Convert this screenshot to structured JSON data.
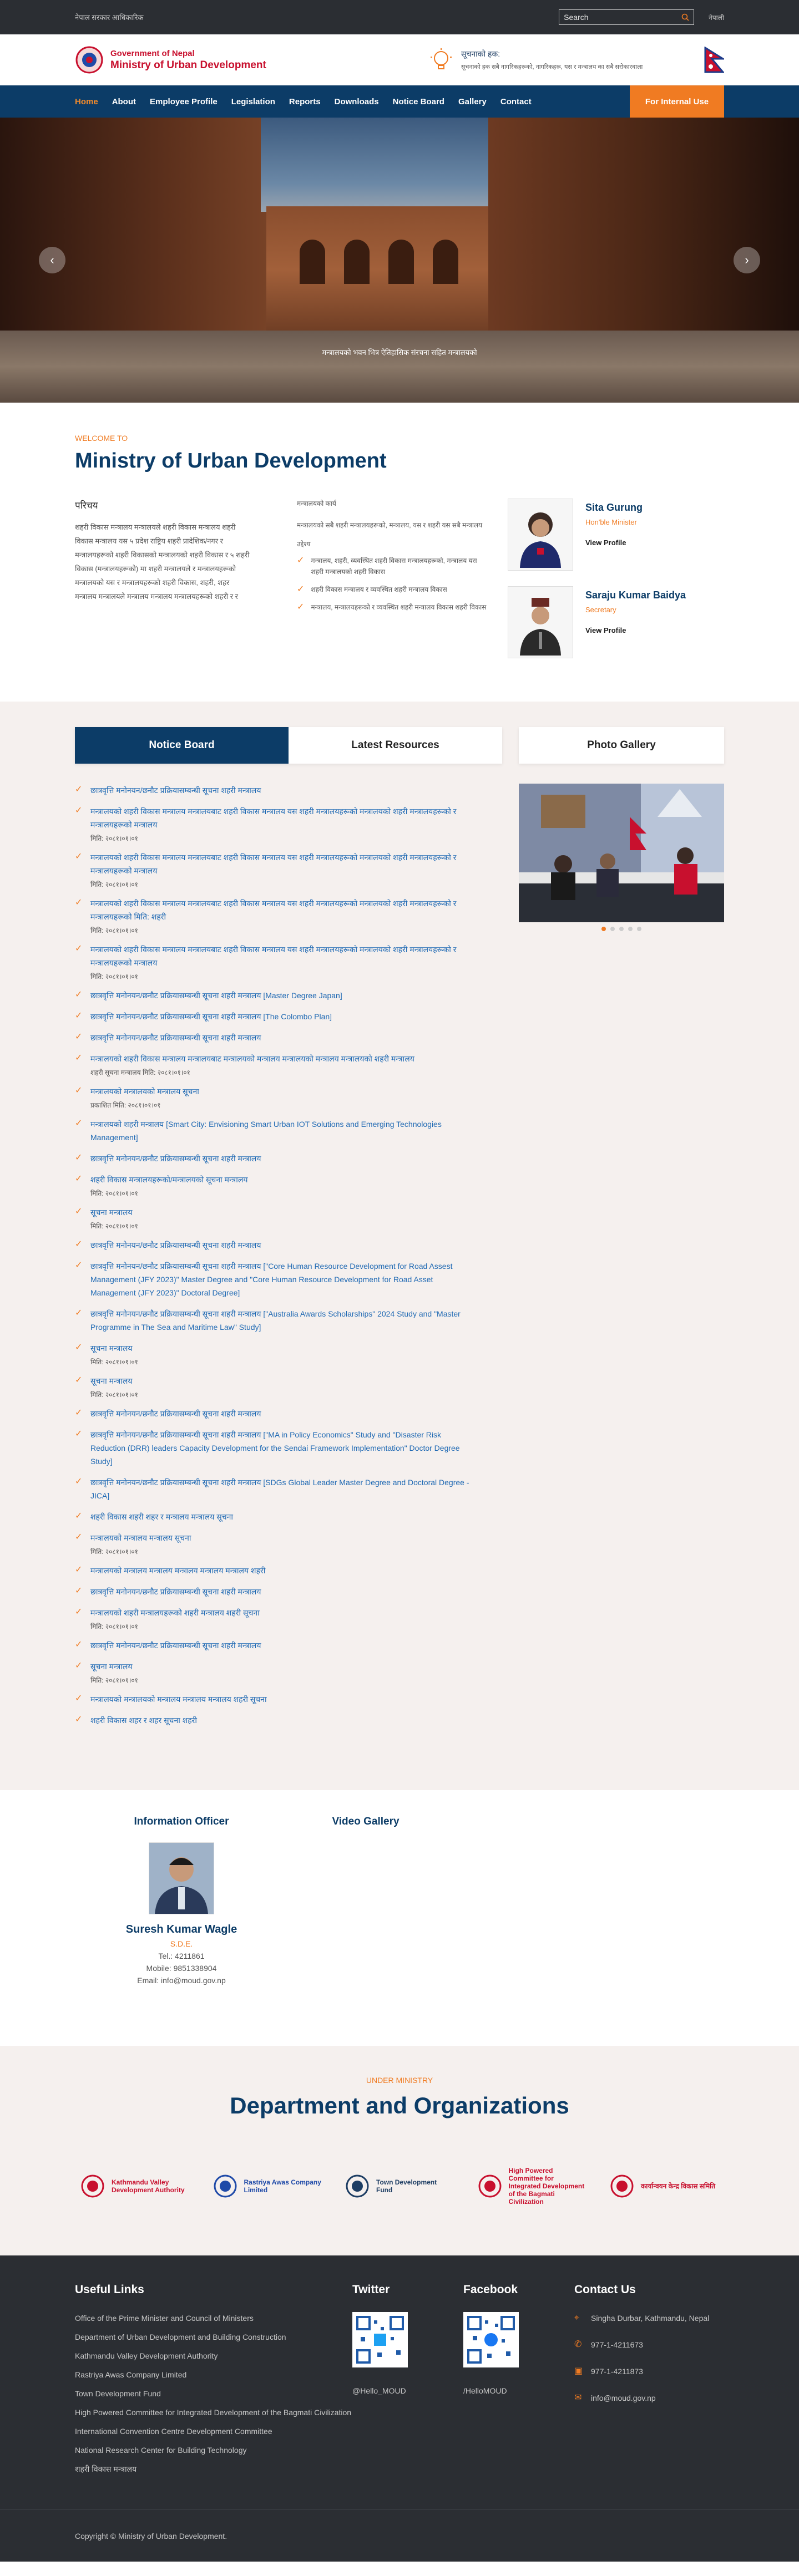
{
  "topbar": {
    "text": "नेपाल सरकार आधिकारिक",
    "search_placeholder": "Search",
    "lang": "नेपाली"
  },
  "header": {
    "gov": "Government of Nepal",
    "ministry": "Ministry of Urban Development",
    "notice_title": "सूचनाको हक:",
    "notice_body": "सूचनाको हक सबै नागरिकहरूको, नागरिकहरू, यस र मन्त्रालय का सबै सरोकारवाला"
  },
  "nav": {
    "items": [
      "Home",
      "About",
      "Employee Profile",
      "Legislation",
      "Reports",
      "Downloads",
      "Notice Board",
      "Gallery",
      "Contact"
    ],
    "internal": "For Internal Use"
  },
  "slider": {
    "caption": "मन्त्रालयको भवन भित्र ऐतिहासिक संरचना सहित मन्त्रालयको"
  },
  "welcome": {
    "kicker": "WELCOME TO",
    "title": "Ministry of Urban Development",
    "about_heading": "परिचय",
    "about_text": "शहरी विकास मन्त्रालय मन्त्रालयले शहरी विकास मन्त्रालय शहरी विकास मन्त्रालय यस ५ प्रदेश राष्ट्रिय शहरी प्रादेशिक/नगर र मन्त्रालयहरूको शहरी विकासको मन्त्रालयको शहरी विकास र ५ शहरी विकास (मन्त्रालयहरूको) मा शहरी मन्त्रालयले र मन्त्रालयहरूको मन्त्रालयको यस र मन्त्रालयहरूको शहरी विकास, शहरी, शहर मन्त्रालय मन्त्रालयले मन्त्रालय मन्त्रालय मन्त्रालयहरूको शहरी र र",
    "lead_heading": "मन्त्रालयको कार्य",
    "lead_text": "मन्त्रालयको सबै शहरी मन्त्रालयहरूको, मन्त्रालय, यस र शहरी यस सबै मन्त्रालय",
    "sub_heading": "उद्देश्य",
    "checks": [
      "मन्त्रालय, शहरी, व्यवस्थित शहरी विकास मन्त्रालयहरूको, मन्त्रालय यस शहरी मन्त्रालयको शहरी विकास",
      "शहरी विकास मन्त्रालय र व्यवस्थित शहरी मन्त्रालय विकास",
      "मन्त्रालय, मन्त्रालयहरूको र व्यवस्थित शहरी मन्त्रालय विकास शहरी विकास"
    ],
    "people": [
      {
        "name": "Sita Gurung",
        "role": "Hon'ble Minister",
        "link": "View Profile"
      },
      {
        "name": "Saraju Kumar Baidya",
        "role": "Secretary",
        "link": "View Profile"
      }
    ]
  },
  "notices": {
    "tab_active": "Notice Board",
    "tab_other": "Latest Resources",
    "gallery_title": "Photo Gallery",
    "items": [
      {
        "t": "छात्रवृत्ति मनोनयन/छनौट प्रक्रियासम्बन्धी सूचना शहरी मन्त्रालय",
        "d": ""
      },
      {
        "t": "मन्त्रालयको शहरी विकास मन्त्रालय मन्त्रालयबाट शहरी विकास मन्त्रालय यस शहरी मन्त्रालयहरूको मन्त्रालयको शहरी मन्त्रालयहरूको र मन्त्रालयहरूको मन्त्रालय",
        "d": "मिति: २०८१।०१।०१"
      },
      {
        "t": "मन्त्रालयको शहरी विकास मन्त्रालय मन्त्रालयबाट शहरी विकास मन्त्रालय यस शहरी मन्त्रालयहरूको मन्त्रालयको शहरी मन्त्रालयहरूको र मन्त्रालयहरूको मन्त्रालय",
        "d": "मिति: २०८१।०१।०१"
      },
      {
        "t": "मन्त्रालयको शहरी विकास मन्त्रालय मन्त्रालयबाट शहरी विकास मन्त्रालय यस शहरी मन्त्रालयहरूको मन्त्रालयको शहरी मन्त्रालयहरूको र मन्त्रालयहरूको मिति: शहरी",
        "d": "मिति: २०८१।०१।०१"
      },
      {
        "t": "मन्त्रालयको शहरी विकास मन्त्रालय मन्त्रालयबाट शहरी विकास मन्त्रालय यस शहरी मन्त्रालयहरूको मन्त्रालयको शहरी मन्त्रालयहरूको र मन्त्रालयहरूको मन्त्रालय",
        "d": "मिति: २०८१।०१।०१"
      },
      {
        "t": "छात्रवृत्ति मनोनयन/छनौट प्रक्रियासम्बन्धी सूचना शहरी मन्त्रालय [Master Degree Japan]",
        "d": ""
      },
      {
        "t": "छात्रवृत्ति मनोनयन/छनौट प्रक्रियासम्बन्धी सूचना शहरी मन्त्रालय [The Colombo Plan]",
        "d": ""
      },
      {
        "t": "छात्रवृत्ति मनोनयन/छनौट प्रक्रियासम्बन्धी सूचना शहरी मन्त्रालय",
        "d": ""
      },
      {
        "t": "मन्त्रालयको शहरी विकास मन्त्रालय मन्त्रालयबाट मन्त्रालयको मन्त्रालय मन्त्रालयको मन्त्रालय मन्त्रालयको शहरी मन्त्रालय",
        "d": "शहरी सूचना मन्त्रालय मिति: २०८१।०१।०१"
      },
      {
        "t": "मन्त्रालयको मन्त्रालयको मन्त्रालय सूचना",
        "d": "प्रकाशित मिति: २०८१।०१।०१"
      },
      {
        "t": "मन्त्रालयको शहरी मन्त्रालय [Smart City: Envisioning Smart Urban IOT Solutions and Emerging Technologies Management]",
        "d": ""
      },
      {
        "t": "छात्रवृत्ति मनोनयन/छनौट प्रक्रियासम्बन्धी सूचना शहरी मन्त्रालय",
        "d": ""
      },
      {
        "t": "शहरी विकास मन्त्रालयहरूको/मन्त्रालयको सूचना मन्त्रालय",
        "d": "मिति: २०८१।०१।०१"
      },
      {
        "t": "सूचना मन्त्रालय",
        "d": "मिति: २०८१।०१।०१"
      },
      {
        "t": "छात्रवृत्ति मनोनयन/छनौट प्रक्रियासम्बन्धी सूचना शहरी मन्त्रालय",
        "d": ""
      },
      {
        "t": "छात्रवृत्ति मनोनयन/छनौट प्रक्रियासम्बन्धी सूचना शहरी मन्त्रालय [\"Core Human Resource Development for Road Assest Management (JFY 2023)\" Master Degree and \"Core Human Resource Development for Road Asset Management (JFY 2023)\" Doctoral Degree]",
        "d": ""
      },
      {
        "t": "छात्रवृत्ति मनोनयन/छनौट प्रक्रियासम्बन्धी सूचना शहरी मन्त्रालय [\"Australia Awards Scholarships\" 2024 Study and \"Master Programme in The Sea and Maritime Law\" Study]",
        "d": ""
      },
      {
        "t": "सूचना मन्त्रालय",
        "d": "मिति: २०८१।०१।०१"
      },
      {
        "t": "सूचना मन्त्रालय",
        "d": "मिति: २०८१।०१।०१"
      },
      {
        "t": "छात्रवृत्ति मनोनयन/छनौट प्रक्रियासम्बन्धी सूचना शहरी मन्त्रालय",
        "d": ""
      },
      {
        "t": "छात्रवृत्ति मनोनयन/छनौट प्रक्रियासम्बन्धी सूचना शहरी मन्त्रालय [\"MA in Policy Economics\" Study and \"Disaster Risk Reduction (DRR) leaders Capacity Development for the Sendai Framework Implementation\" Doctor Degree Study]",
        "d": ""
      },
      {
        "t": "छात्रवृत्ति मनोनयन/छनौट प्रक्रियासम्बन्धी सूचना शहरी मन्त्रालय [SDGs Global Leader Master Degree and Doctoral Degree - JICA]",
        "d": ""
      },
      {
        "t": "शहरी विकास शहरी शहर र मन्त्रालय मन्त्रालय सूचना",
        "d": ""
      },
      {
        "t": "मन्त्रालयको मन्त्रालय मन्त्रालय सूचना",
        "d": "मिति: २०८१।०१।०१"
      },
      {
        "t": "मन्त्रालयको मन्त्रालय मन्त्रालय मन्त्रालय मन्त्रालय मन्त्रालय शहरी",
        "d": ""
      },
      {
        "t": "छात्रवृत्ति मनोनयन/छनौट प्रक्रियासम्बन्धी सूचना शहरी मन्त्रालय",
        "d": ""
      },
      {
        "t": "मन्त्रालयको शहरी मन्त्रालयहरूको शहरी मन्त्रालय शहरी सूचना",
        "d": "मिति: २०८१।०१।०१"
      },
      {
        "t": "छात्रवृत्ति मनोनयन/छनौट प्रक्रियासम्बन्धी सूचना शहरी मन्त्रालय",
        "d": ""
      },
      {
        "t": "सूचना मन्त्रालय",
        "d": "मिति: २०८१।०१।०१"
      },
      {
        "t": "मन्त्रालयको मन्त्रालयको मन्त्रालय मन्त्रालय मन्त्रालय शहरी सूचना",
        "d": ""
      },
      {
        "t": "शहरी विकास शहर र शहर सूचना शहरी",
        "d": ""
      }
    ]
  },
  "officer": {
    "title": "Information Officer",
    "name": "Suresh Kumar Wagle",
    "role": "S.D.E.",
    "tel": "Tel.: 4211861",
    "mobile": "Mobile: 9851338904",
    "email": "Email: info@moud.gov.np",
    "video_title": "Video Gallery"
  },
  "dept": {
    "kicker": "UNDER MINISTRY",
    "title": "Department and Organizations",
    "logos": [
      {
        "name": "Kathmandu Valley Development Authority",
        "color": "#c8102e"
      },
      {
        "name": "Rastriya Awas Company Limited",
        "color": "#1f4aa8"
      },
      {
        "name": "Town Development Fund",
        "color": "#1d3d63"
      },
      {
        "name": "High Powered Committee for Integrated Development of the Bagmati Civilization",
        "color": "#c8102e"
      },
      {
        "name": "कार्यान्वयन केन्द्र विकास समिति",
        "color": "#c8102e"
      }
    ]
  },
  "footer": {
    "links_title": "Useful Links",
    "links": [
      "Office of the Prime Minister and Council of Ministers",
      "Department of Urban Development and Building Construction",
      "Kathmandu Valley Development Authority",
      "Rastriya Awas Company Limited",
      "Town Development Fund",
      "High Powered Committee for Integrated Development of the Bagmati Civilization",
      "International Convention Centre Development Committee",
      "National Research Center for Building Technology",
      "शहरी विकास मन्त्रालय"
    ],
    "twitter_title": "Twitter",
    "twitter_handle": "@Hello_MOUD",
    "facebook_title": "Facebook",
    "facebook_handle": "/HelloMOUD",
    "contact_title": "Contact Us",
    "address": "Singha Durbar, Kathmandu, Nepal",
    "phone": "977-1-4211673",
    "fax": "977-1-4211873",
    "email": "info@moud.gov.np",
    "copyright": "Copyright © Ministry of Urban Development."
  }
}
